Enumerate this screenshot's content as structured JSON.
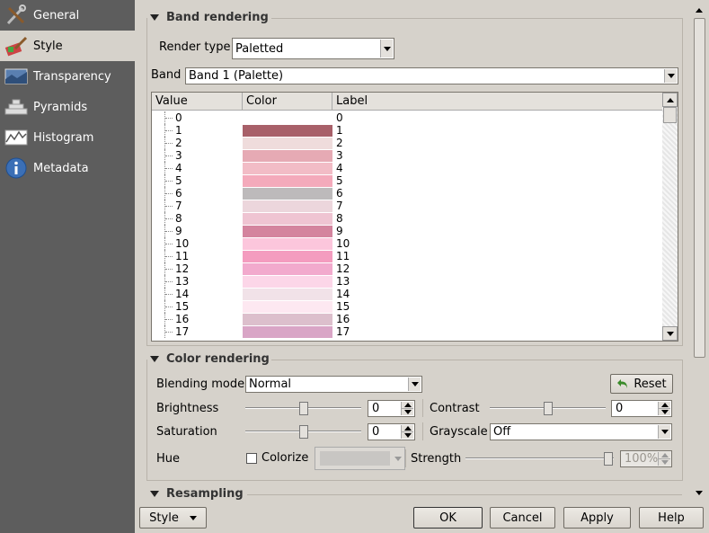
{
  "sidebar": {
    "items": [
      {
        "label": "General",
        "icon": "tools-icon",
        "active": false
      },
      {
        "label": "Style",
        "icon": "brush-icon",
        "active": true
      },
      {
        "label": "Transparency",
        "icon": "transparency-icon",
        "active": false
      },
      {
        "label": "Pyramids",
        "icon": "pyramids-icon",
        "active": false
      },
      {
        "label": "Histogram",
        "icon": "histogram-icon",
        "active": false
      },
      {
        "label": "Metadata",
        "icon": "info-icon",
        "active": false
      }
    ]
  },
  "band_rendering": {
    "title": "Band rendering",
    "render_type_label": "Render type",
    "render_type_value": "Paletted",
    "band_label": "Band",
    "band_value": "Band 1 (Palette)",
    "columns": [
      "Value",
      "Color",
      "Label"
    ],
    "rows": [
      {
        "value": "0",
        "color": "#ffffff",
        "label": "0"
      },
      {
        "value": "1",
        "color": "#a86069",
        "label": "1"
      },
      {
        "value": "2",
        "color": "#efdcdc",
        "label": "2"
      },
      {
        "value": "3",
        "color": "#e6aab4",
        "label": "3"
      },
      {
        "value": "4",
        "color": "#f2bcc6",
        "label": "4"
      },
      {
        "value": "5",
        "color": "#f4aabb",
        "label": "5"
      },
      {
        "value": "6",
        "color": "#bdbabb",
        "label": "6"
      },
      {
        "value": "7",
        "color": "#ecd6dc",
        "label": "7"
      },
      {
        "value": "8",
        "color": "#efc4d2",
        "label": "8"
      },
      {
        "value": "9",
        "color": "#d4849e",
        "label": "9"
      },
      {
        "value": "10",
        "color": "#fcc6dc",
        "label": "10"
      },
      {
        "value": "11",
        "color": "#f49cbf",
        "label": "11"
      },
      {
        "value": "12",
        "color": "#f2aacd",
        "label": "12"
      },
      {
        "value": "13",
        "color": "#fcd6e8",
        "label": "13"
      },
      {
        "value": "14",
        "color": "#f1e2e8",
        "label": "14"
      },
      {
        "value": "15",
        "color": "#fde8f1",
        "label": "15"
      },
      {
        "value": "16",
        "color": "#dcbfcc",
        "label": "16"
      },
      {
        "value": "17",
        "color": "#d9a5c6",
        "label": "17"
      }
    ]
  },
  "color_rendering": {
    "title": "Color rendering",
    "blending_label": "Blending mode",
    "blending_value": "Normal",
    "reset_label": "Reset",
    "brightness_label": "Brightness",
    "brightness_value": "0",
    "contrast_label": "Contrast",
    "contrast_value": "0",
    "saturation_label": "Saturation",
    "saturation_value": "0",
    "grayscale_label": "Grayscale",
    "grayscale_value": "Off",
    "hue_label": "Hue",
    "colorize_label": "Colorize",
    "strength_label": "Strength",
    "strength_value": "100%"
  },
  "resampling": {
    "title": "Resampling"
  },
  "footer": {
    "style_label": "Style",
    "ok_label": "OK",
    "cancel_label": "Cancel",
    "apply_label": "Apply",
    "help_label": "Help"
  }
}
